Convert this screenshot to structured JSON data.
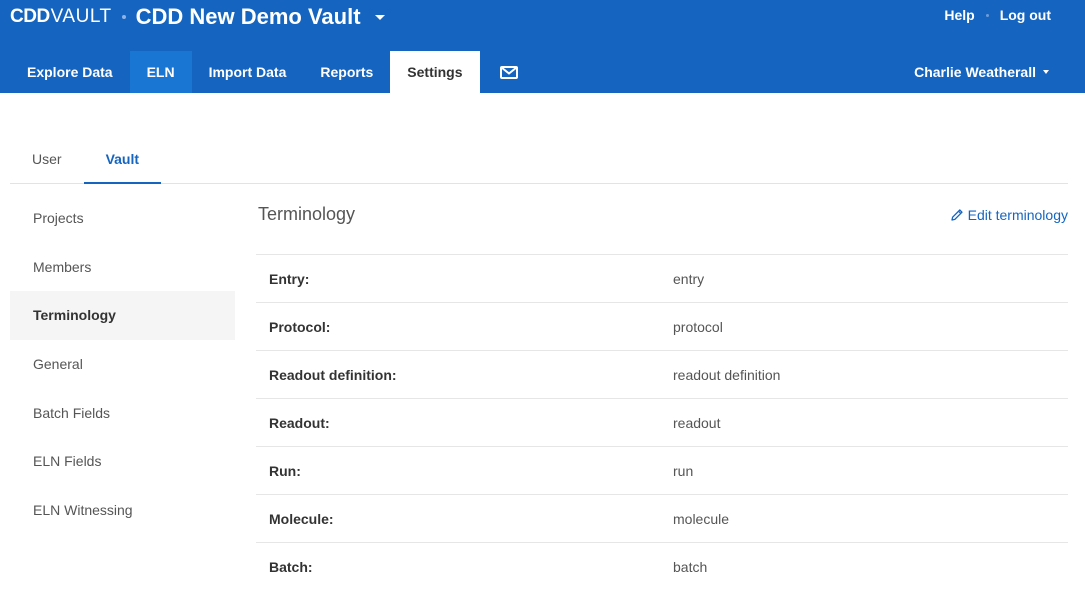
{
  "brand": {
    "logo_cdd": "CDD",
    "logo_vault": "VAULT",
    "vault_name": "CDD New Demo Vault"
  },
  "top_links": {
    "help": "Help",
    "logout": "Log out"
  },
  "nav_tabs": [
    {
      "label": "Explore Data"
    },
    {
      "label": "ELN"
    },
    {
      "label": "Import Data"
    },
    {
      "label": "Reports"
    },
    {
      "label": "Settings"
    }
  ],
  "user": {
    "name": "Charlie Weatherall"
  },
  "sub_tabs": [
    {
      "label": "User"
    },
    {
      "label": "Vault"
    }
  ],
  "sidebar": {
    "items": [
      {
        "label": "Projects"
      },
      {
        "label": "Members"
      },
      {
        "label": "Terminology"
      },
      {
        "label": "General"
      },
      {
        "label": "Batch Fields"
      },
      {
        "label": "ELN Fields"
      },
      {
        "label": "ELN Witnessing"
      }
    ]
  },
  "main": {
    "title": "Terminology",
    "edit_label": "Edit terminology",
    "rows": [
      {
        "label": "Entry:",
        "value": "entry"
      },
      {
        "label": "Protocol:",
        "value": "protocol"
      },
      {
        "label": "Readout definition:",
        "value": "readout definition"
      },
      {
        "label": "Readout:",
        "value": "readout"
      },
      {
        "label": "Run:",
        "value": "run"
      },
      {
        "label": "Molecule:",
        "value": "molecule"
      },
      {
        "label": "Batch:",
        "value": "batch"
      }
    ]
  },
  "colors": {
    "header_bg": "#1565c0",
    "eln_tab_bg": "#1976d2",
    "accent": "#1565c0"
  },
  "icons": {
    "mail": "envelope-icon",
    "edit": "pencil-icon",
    "vault_dropdown": "caret-down-icon",
    "user_dropdown": "caret-down-icon"
  }
}
